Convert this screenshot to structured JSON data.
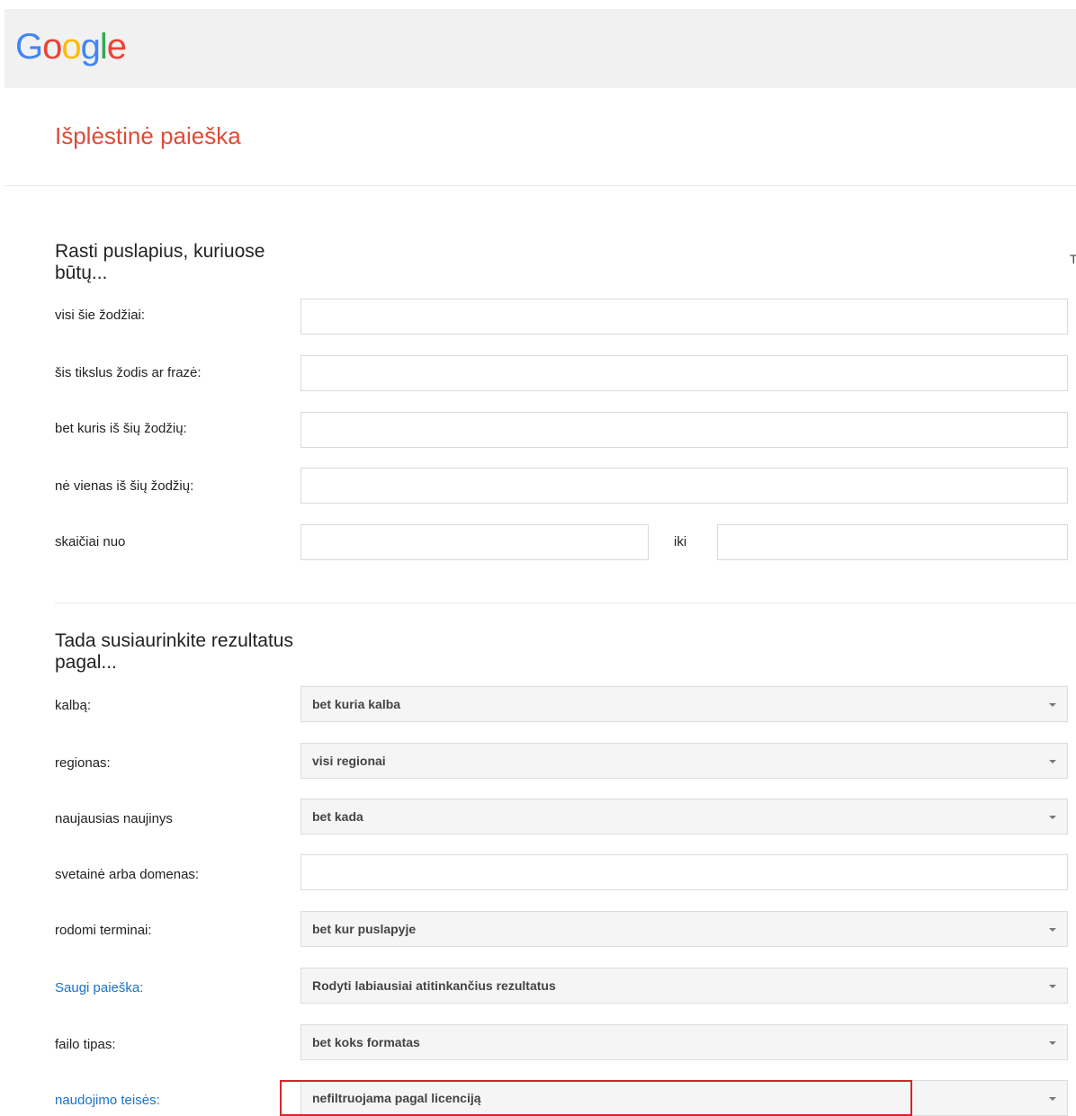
{
  "logo": {
    "letters": [
      "G",
      "o",
      "o",
      "g",
      "l",
      "e"
    ]
  },
  "page_title": "Išplėstinė paieška",
  "side_letter": "T",
  "find_section": {
    "heading": "Rasti puslapius, kuriuose būtų...",
    "fields": [
      {
        "label": "visi šie žodžiai:",
        "value": ""
      },
      {
        "label": "šis tikslus žodis ar frazė:",
        "value": ""
      },
      {
        "label": "bet kuris iš šių žodžių:",
        "value": ""
      },
      {
        "label": "nė vienas iš šių žodžių:",
        "value": ""
      }
    ],
    "numbers": {
      "label": "skaičiai nuo",
      "to_label": "iki",
      "from_value": "",
      "to_value": ""
    }
  },
  "narrow_section": {
    "heading": "Tada susiaurinkite rezultatus pagal...",
    "language": {
      "label": "kalbą:",
      "value": "bet kuria kalba"
    },
    "region": {
      "label": "regionas:",
      "value": "visi regionai"
    },
    "last_update": {
      "label": "naujausias naujinys",
      "value": "bet kada"
    },
    "site": {
      "label": "svetainė arba domenas:",
      "value": ""
    },
    "terms": {
      "label": "rodomi terminai:",
      "value": "bet kur puslapyje"
    },
    "safe_search": {
      "label": "Saugi paieška:",
      "value": "Rodyti labiausiai atitinkančius rezultatus"
    },
    "file_type": {
      "label": "failo tipas:",
      "value": "bet koks formatas"
    },
    "usage_rights": {
      "label": "naudojimo teisės:",
      "value": "nefiltruojama pagal licenciją"
    }
  },
  "colors": {
    "title": "#dd4b39",
    "link": "#1a73c9",
    "highlight": "#d9232a",
    "logo": [
      "#4285f4",
      "#ea4335",
      "#fbbc05",
      "#4285f4",
      "#34a853",
      "#ea4335"
    ]
  }
}
